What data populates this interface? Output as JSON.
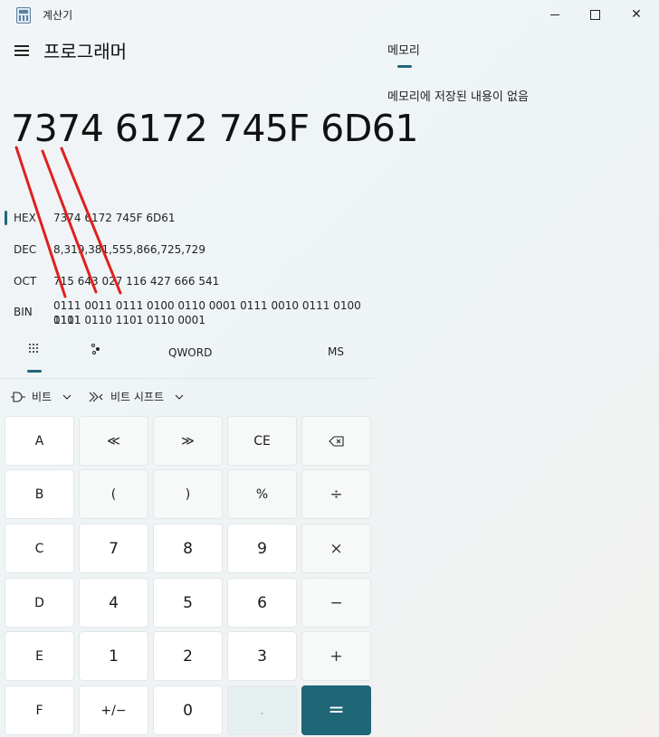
{
  "window": {
    "title": "계산기",
    "minimize_icon": "minimize-icon",
    "maximize_icon": "maximize-icon",
    "close_label": "✕"
  },
  "header": {
    "menu_icon": "hamburger-menu-icon",
    "mode_title": "프로그래머"
  },
  "display": {
    "value": "7374 6172 745F 6D61"
  },
  "radix": [
    {
      "label": "HEX",
      "value": "7374 6172 745F 6D61",
      "selected": true
    },
    {
      "label": "DEC",
      "value": "8,319,381,555,866,725,729"
    },
    {
      "label": "OCT",
      "value": "715 643 027 116 427 666 541"
    },
    {
      "label": "BIN",
      "value_line1": "0111 0011 0111 0100 0110 0001 0111 0010 0111 0100 0101",
      "value_line2": "1111 0110 1101 0110 0001"
    }
  ],
  "tabs": {
    "keypad_icon": "full-keypad-icon",
    "bit_toggle_icon": "bit-toggling-keypad-icon",
    "word_size": "QWORD",
    "memory_store": "MS"
  },
  "bit_tools": {
    "bitwise_label": "비트",
    "shift_label": "비트 시프트",
    "chevron": "⌄"
  },
  "keys": [
    [
      "A",
      "≪",
      "≫",
      "CE",
      "⌫"
    ],
    [
      "B",
      "(",
      ")",
      "%",
      "÷"
    ],
    [
      "C",
      "7",
      "8",
      "9",
      "×"
    ],
    [
      "D",
      "4",
      "5",
      "6",
      "−"
    ],
    [
      "E",
      "1",
      "2",
      "3",
      "+"
    ],
    [
      "F",
      "+/−",
      "0",
      ".",
      "="
    ]
  ],
  "memory": {
    "title": "메모리",
    "empty_message": "메모리에 저장된 내용이 없음"
  },
  "colors": {
    "accent": "#1f6677",
    "annotation": "#e0201f"
  }
}
